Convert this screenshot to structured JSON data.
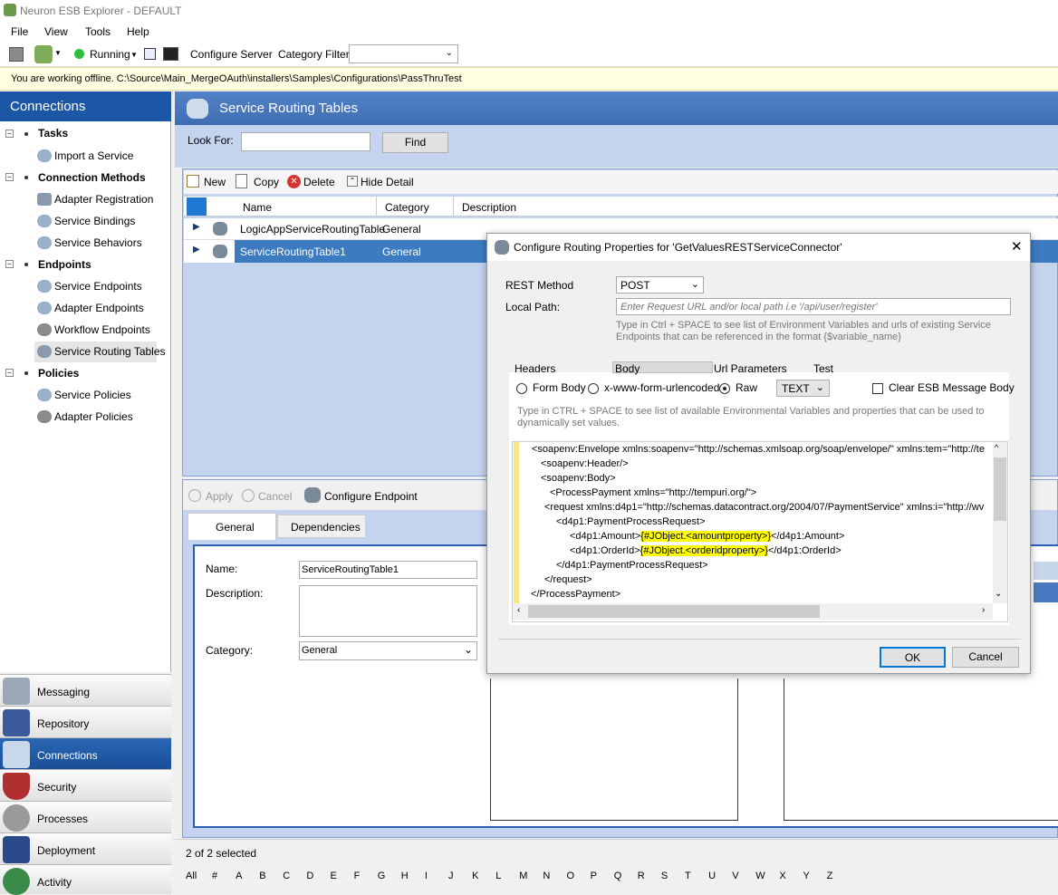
{
  "window": {
    "title": "Neuron ESB Explorer - DEFAULT"
  },
  "menu": {
    "file": "File",
    "view": "View",
    "tools": "Tools",
    "help": "Help"
  },
  "toolbar": {
    "running": "Running",
    "configure_server": "Configure Server",
    "category_filter": "Category Filter",
    "category_value": ""
  },
  "offline_msg": "You are working offline. C:\\Source\\Main_MergeOAuth\\installers\\Samples\\Configurations\\PassThruTest",
  "left": {
    "title": "Connections",
    "tasks": "Tasks",
    "import_service": "Import a Service",
    "connection_methods": "Connection Methods",
    "adapter_registration": "Adapter Registration",
    "service_bindings": "Service Bindings",
    "service_behaviors": "Service Behaviors",
    "endpoints": "Endpoints",
    "service_endpoints": "Service Endpoints",
    "adapter_endpoints": "Adapter Endpoints",
    "workflow_endpoints": "Workflow Endpoints",
    "service_routing_tables": "Service Routing Tables",
    "policies": "Policies",
    "service_policies": "Service Policies",
    "adapter_policies": "Adapter Policies"
  },
  "nav": {
    "messaging": "Messaging",
    "repository": "Repository",
    "connections": "Connections",
    "security": "Security",
    "processes": "Processes",
    "deployment": "Deployment",
    "activity": "Activity"
  },
  "main": {
    "title": "Service Routing Tables",
    "look_for": "Look For:",
    "find": "Find",
    "new": "New",
    "copy": "Copy",
    "delete": "Delete",
    "hide_detail": "Hide Detail",
    "col_name": "Name",
    "col_category": "Category",
    "col_description": "Description",
    "rows": [
      {
        "name": "LogicAppServiceRoutingTable",
        "category": "General"
      },
      {
        "name": "ServiceRoutingTable1",
        "category": "General"
      }
    ],
    "apply": "Apply",
    "cancel": "Cancel",
    "configure_endpoint": "Configure Endpoint",
    "tab_general": "General",
    "tab_dependencies": "Dependencies",
    "name_label": "Name:",
    "name_value": "ServiceRoutingTable1",
    "desc_label": "Description:",
    "category_label": "Category:",
    "category_value": "General",
    "status": "2 of 2 selected"
  },
  "alphabet": [
    "All",
    "#",
    "A",
    "B",
    "C",
    "D",
    "E",
    "F",
    "G",
    "H",
    "I",
    "J",
    "K",
    "L",
    "M",
    "N",
    "O",
    "P",
    "Q",
    "R",
    "S",
    "T",
    "U",
    "V",
    "W",
    "X",
    "Y",
    "Z"
  ],
  "dialog": {
    "title": "Configure Routing Properties for 'GetValuesRESTServiceConnector'",
    "rest_method_label": "REST Method",
    "rest_method": "POST",
    "local_path_label": "Local Path:",
    "local_path_placeholder": "Enter Request URL and/or local path i.e '/api/user/register'",
    "hint1": "Type in Ctrl + SPACE to see list of Environment Variables and urls of existing Service",
    "hint1b": "Endpoints that can be referenced in the format {$variable_name}",
    "tab_headers": "Headers",
    "tab_body": "Body",
    "tab_url": "Url Parameters",
    "tab_test": "Test",
    "form_body": "Form Body",
    "urlencoded": "x-www-form-urlencoded",
    "raw": "Raw",
    "text": "TEXT",
    "clear_body": "Clear ESB Message Body",
    "hint2": "Type in CTRL + SPACE to see list of available Environmental Variables and properties that can be used to",
    "hint2b": "dynamically set values.",
    "code": {
      "l1": "<soapenv:Envelope xmlns:soapenv=\"http://schemas.xmlsoap.org/soap/envelope/\" xmlns:tem=\"http://te",
      "l2": "<soapenv:Header/>",
      "l3": "<soapenv:Body>",
      "l4": "<ProcessPayment xmlns=\"http://tempuri.org/\">",
      "l5": "<request xmlns:d4p1=\"http://schemas.datacontract.org/2004/07/PaymentService\" xmlns:i=\"http://wv",
      "l6": "<d4p1:PaymentProcessRequest>",
      "l7a": "<d4p1:Amount>",
      "l7b": "{#JObject.<amountproperty>}",
      "l7c": "</d4p1:Amount>",
      "l8a": "<d4p1:OrderId>",
      "l8b": "{#JObject.<orderidproperty>}",
      "l8c": "</d4p1:OrderId>",
      "l9": "</d4p1:PaymentProcessRequest>",
      "l10": "</request>",
      "l11": "</ProcessPayment>"
    },
    "ok": "OK",
    "cancel": "Cancel"
  }
}
